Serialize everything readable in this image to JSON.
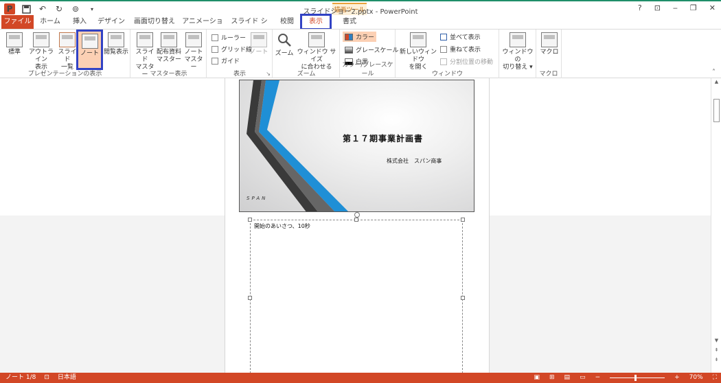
{
  "window": {
    "title": "スライドショー2.pptx - PowerPoint",
    "context_tab_header": "描画ツール",
    "help": "?",
    "minimize": "‒",
    "restore": "❐",
    "close": "✕",
    "ribbon_display": "⊡"
  },
  "tabs": [
    {
      "label": "ファイル"
    },
    {
      "label": "ホーム"
    },
    {
      "label": "挿入"
    },
    {
      "label": "デザイン"
    },
    {
      "label": "画面切り替え"
    },
    {
      "label": "アニメーション"
    },
    {
      "label": "スライド ショー"
    },
    {
      "label": "校閲"
    },
    {
      "label": "表示"
    },
    {
      "label": "書式"
    }
  ],
  "active_tab": "表示",
  "ribbon": {
    "presentation_views": {
      "label": "プレゼンテーションの表示",
      "normal": "標準",
      "outline_1": "アウトライン",
      "outline_2": "表示",
      "slide_sorter_1": "スライド",
      "slide_sorter_2": "一覧",
      "notes": "ノート",
      "reading": "閲覧表示"
    },
    "master_views": {
      "label": "マスター表示",
      "slide_master_1": "スライド",
      "slide_master_2": "マスター",
      "handout_master_1": "配布資料",
      "handout_master_2": "マスター",
      "notes_master_1": "ノート",
      "notes_master_2": "マスター"
    },
    "show": {
      "label": "表示",
      "ruler": "ルーラー",
      "gridlines": "グリッド線",
      "guides": "ガイド",
      "notes": "ノート"
    },
    "zoom": {
      "label": "ズーム",
      "zoom": "ズーム",
      "fit_1": "ウィンドウ サイズ",
      "fit_2": "に合わせる"
    },
    "color": {
      "label": "カラー/グレースケール",
      "color": "カラー",
      "grayscale": "グレースケール",
      "bw": "白黒"
    },
    "window": {
      "label": "ウィンドウ",
      "new_1": "新しいウィンドウ",
      "new_2": "を開く",
      "arrange": "並べて表示",
      "cascade": "重ねて表示",
      "split": "分割位置の移動"
    },
    "switch": {
      "switch_1": "ウィンドウの",
      "switch_2": "切り替え ▾"
    },
    "macros": {
      "label": "マクロ",
      "macro": "マクロ"
    },
    "collapse": "˄"
  },
  "slide": {
    "title": "第１７期事業計画書",
    "subtitle": "株式会社　スパン商事",
    "logo": "SPAN"
  },
  "notes": {
    "text": "開始のあいさつ、10秒"
  },
  "statusbar": {
    "page": "ノート 1/8",
    "language": "日本語",
    "zoom": "70%",
    "zoom_minus": "−",
    "zoom_plus": "+"
  },
  "colors": {
    "accent": "#d24726",
    "highlight": "#3142c4",
    "active_fill": "#fcd0b4"
  }
}
